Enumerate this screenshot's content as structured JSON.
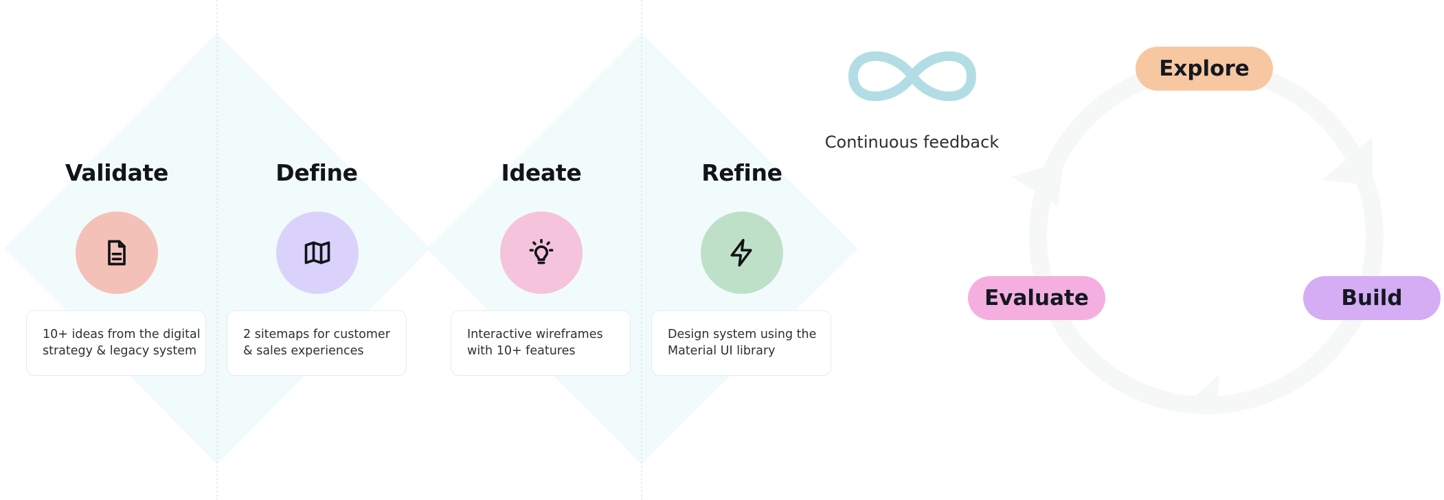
{
  "stages": [
    {
      "title": "Validate",
      "icon": "document-icon",
      "color": "#f4c1b8",
      "line1": "10+ ideas from the digital",
      "line2": "strategy & legacy system"
    },
    {
      "title": "Define",
      "icon": "map-icon",
      "color": "#dad2fb",
      "line1": "2 sitemaps for customer",
      "line2": "& sales experiences"
    },
    {
      "title": "Ideate",
      "icon": "lightbulb-icon",
      "color": "#f5c3dc",
      "line1": "Interactive wireframes",
      "line2": "with 10+ features"
    },
    {
      "title": "Refine",
      "icon": "lightning-icon",
      "color": "#bfe0c8",
      "line1": "Design system using the",
      "line2": "Material UI library"
    }
  ],
  "feedback": {
    "label": "Continuous feedback",
    "icon": "infinity-icon",
    "color": "#b3dde4"
  },
  "cycle": {
    "explore": {
      "label": "Explore",
      "color": "#f6c7a1"
    },
    "build": {
      "label": "Build",
      "color": "#d4adf5"
    },
    "evaluate": {
      "label": "Evaluate",
      "color": "#f4afe0"
    }
  },
  "colors": {
    "diamond": "#eef9fa",
    "divider": "#cfe5e8",
    "cycle_ring": "#f6f7f7"
  }
}
